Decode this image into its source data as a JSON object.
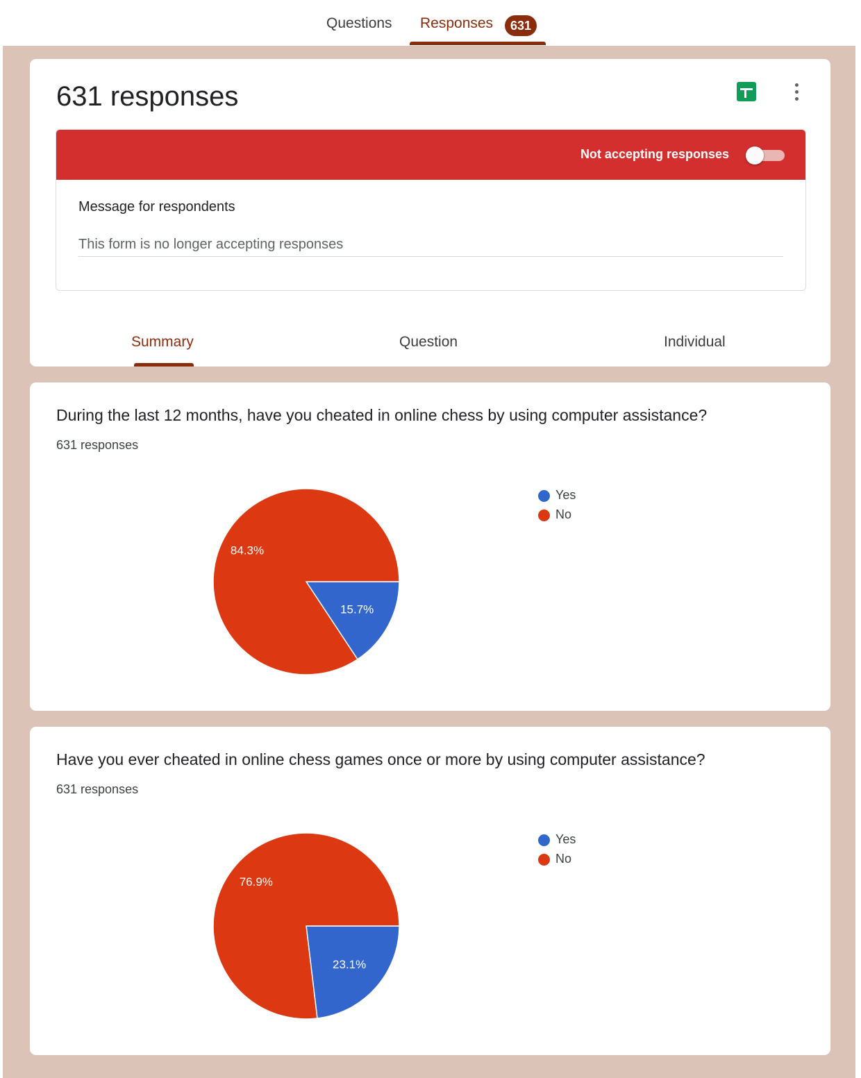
{
  "nav": {
    "tabs": [
      {
        "label": "Questions"
      },
      {
        "label": "Responses",
        "badge": "631"
      }
    ]
  },
  "header": {
    "title": "631 responses",
    "sheets_icon": "google-sheets-icon",
    "more_icon": "more-vert-icon",
    "status_text": "Not accepting responses",
    "accepting_responses": false,
    "message_label": "Message for respondents",
    "message_value": "This form is no longer accepting responses",
    "subtabs": [
      {
        "label": "Summary",
        "active": true
      },
      {
        "label": "Question",
        "active": false
      },
      {
        "label": "Individual",
        "active": false
      }
    ]
  },
  "colors": {
    "accent": "#8a2d0c",
    "status_red": "#d32f2f",
    "yes": "#3366cc",
    "no": "#dc3912",
    "sheets_green": "#0f9d58",
    "backdrop": "#dcc3b7"
  },
  "questions": [
    {
      "title": "During the last 12 months, have you cheated in online chess by using computer assistance?",
      "count": "631 responses"
    },
    {
      "title": "Have you ever cheated in online chess games once or more by using computer assistance?",
      "count": "631 responses"
    }
  ],
  "chart_data": [
    {
      "type": "pie",
      "categories": [
        "Yes",
        "No"
      ],
      "values": [
        15.7,
        84.3
      ],
      "labels": [
        "15.7%",
        "84.3%"
      ],
      "legend": "right"
    },
    {
      "type": "pie",
      "categories": [
        "Yes",
        "No"
      ],
      "values": [
        23.1,
        76.9
      ],
      "labels": [
        "23.1%",
        "76.9%"
      ],
      "legend": "right"
    }
  ]
}
